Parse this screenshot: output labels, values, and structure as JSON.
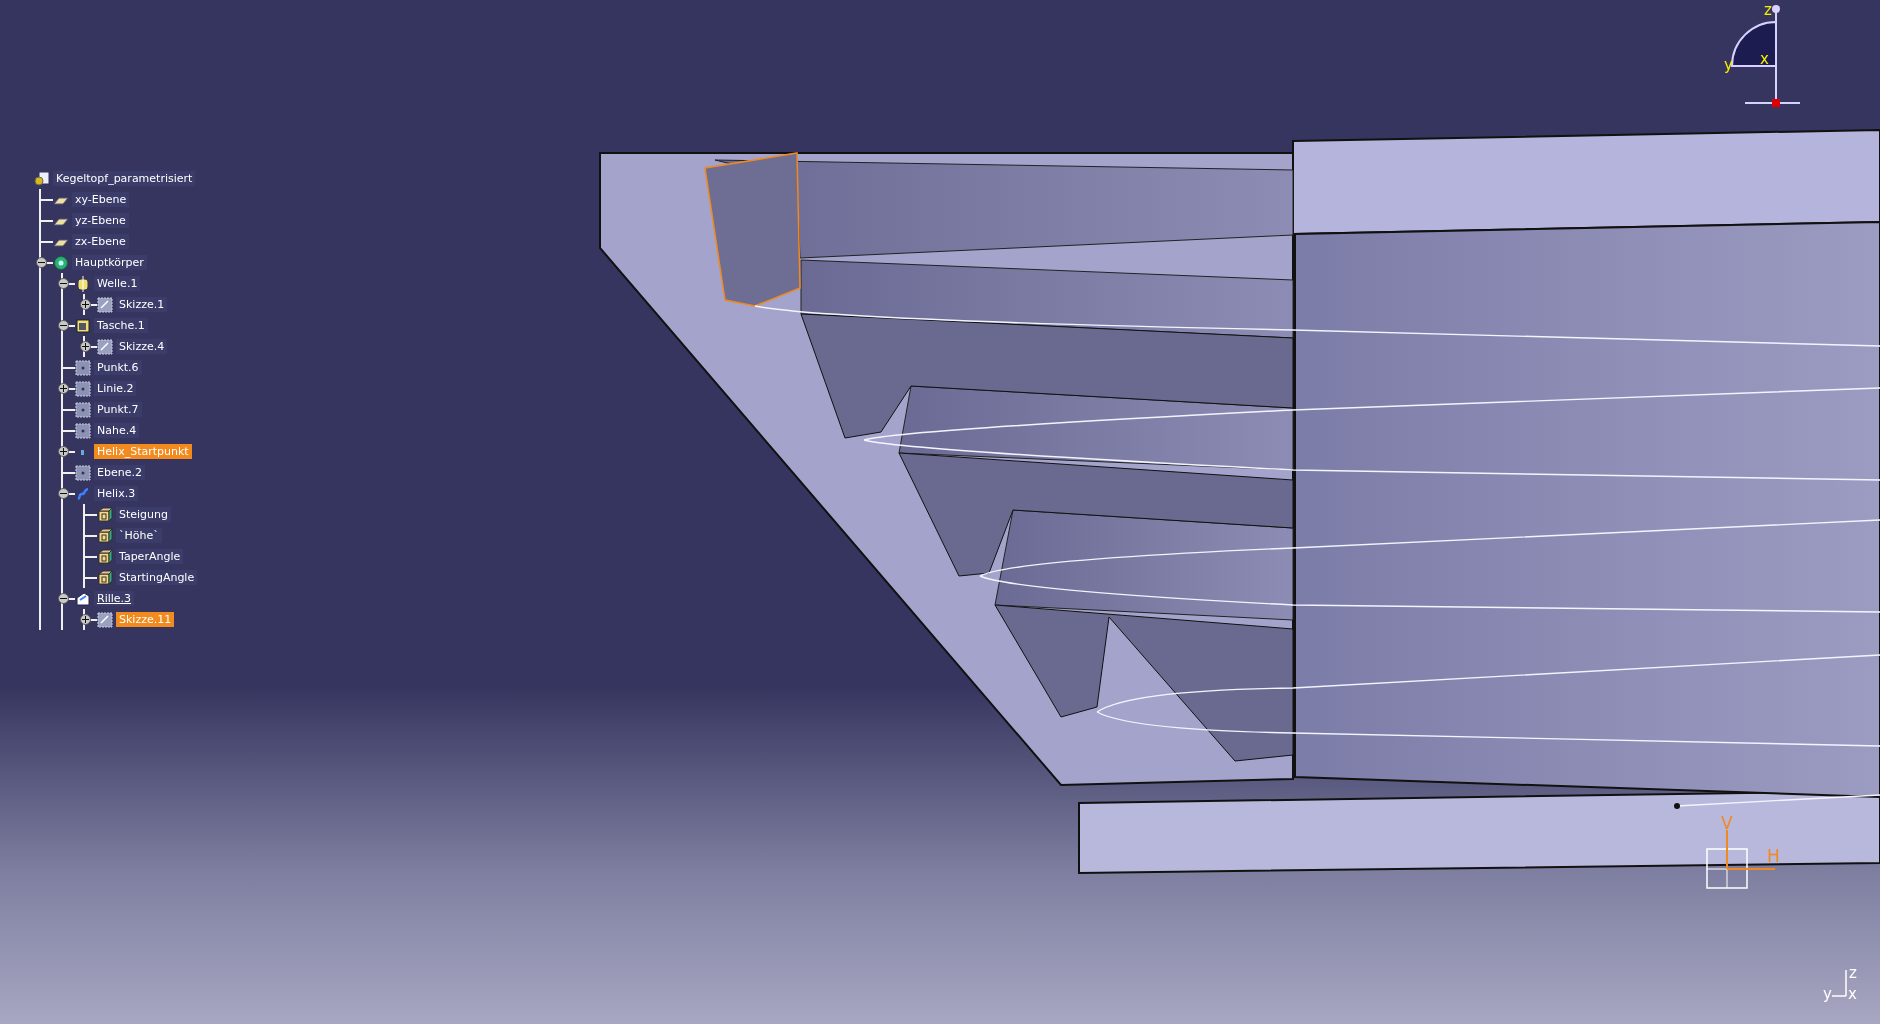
{
  "tree": {
    "label": "Kegeltopf_parametrisiert",
    "kind": "part",
    "selected": false,
    "children": [
      {
        "label": "xy-Ebene",
        "kind": "plane",
        "selected": false
      },
      {
        "label": "yz-Ebene",
        "kind": "plane",
        "selected": false
      },
      {
        "label": "zx-Ebene",
        "kind": "plane",
        "selected": false
      },
      {
        "label": "Hauptkörper",
        "kind": "body",
        "selected": false,
        "expanded": true,
        "children": [
          {
            "label": "Welle.1",
            "kind": "shaft",
            "selected": false,
            "expanded": true,
            "children": [
              {
                "label": "Skizze.1",
                "kind": "sketch",
                "selected": false,
                "expanded": false
              }
            ]
          },
          {
            "label": "Tasche.1",
            "kind": "pocket",
            "selected": false,
            "expanded": true,
            "children": [
              {
                "label": "Skizze.4",
                "kind": "sketch",
                "selected": false,
                "expanded": false
              }
            ]
          },
          {
            "label": "Punkt.6",
            "kind": "geometry",
            "selected": false
          },
          {
            "label": "Linie.2",
            "kind": "geometry",
            "selected": false,
            "expanded": false
          },
          {
            "label": "Punkt.7",
            "kind": "geometry",
            "selected": false
          },
          {
            "label": "Nahe.4",
            "kind": "geometry",
            "selected": false
          },
          {
            "label": "Helix_Startpunkt",
            "kind": "point",
            "selected": true,
            "expanded": false
          },
          {
            "label": "Ebene.2",
            "kind": "geometry",
            "selected": false
          },
          {
            "label": "Helix.3",
            "kind": "helix",
            "selected": false,
            "expanded": true,
            "children": [
              {
                "label": "Steigung",
                "kind": "parameter",
                "selected": false
              },
              {
                "label": "`Höhe`",
                "kind": "parameter",
                "selected": false
              },
              {
                "label": "TaperAngle",
                "kind": "parameter",
                "selected": false
              },
              {
                "label": "StartingAngle",
                "kind": "parameter",
                "selected": false
              }
            ]
          },
          {
            "label": "Rille.3",
            "kind": "groove",
            "selected": false,
            "current": true,
            "expanded": true,
            "children": [
              {
                "label": "Skizze.11",
                "kind": "sketch",
                "selected": true,
                "expanded": false
              }
            ]
          }
        ]
      }
    ]
  },
  "compass": {
    "z": "z",
    "y": "y",
    "x": "x"
  },
  "sketch_axes": {
    "v": "V",
    "h": "H"
  },
  "corner_axes": {
    "z": "z",
    "y": "y",
    "x": "x"
  }
}
